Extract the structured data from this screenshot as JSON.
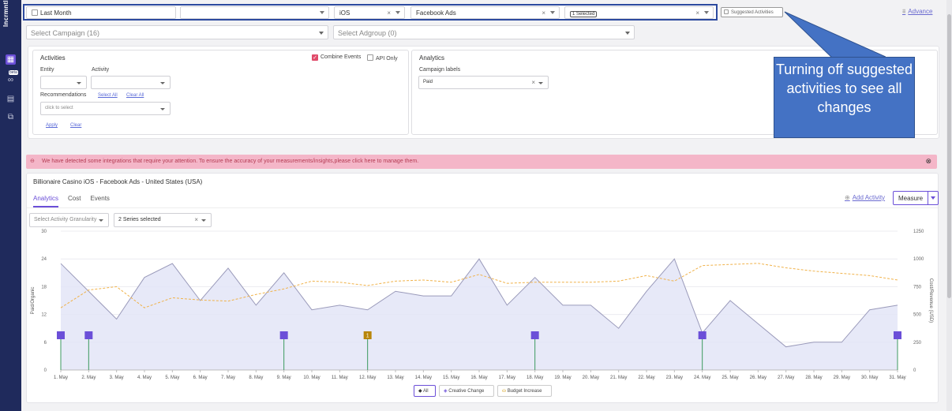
{
  "sidebar": {
    "brand": "Incrmntl",
    "beta": "beta"
  },
  "filters": {
    "date_range": "Last Month",
    "app": "",
    "platform": "iOS",
    "network": "Facebook Ads",
    "selection_count": "1 Selected",
    "suggested_activities": "Suggested Activities",
    "advance": "Advance",
    "campaign_placeholder": "Select Campaign (16)",
    "adgroup_placeholder": "Select Adgroup (0)"
  },
  "activities_panel": {
    "title": "Activities",
    "combine_events": "Combine Events",
    "api_only": "API Only",
    "entity_label": "Entity",
    "activity_label": "Activity",
    "recommendations_label": "Recommendations",
    "select_all": "Select All",
    "clear_all": "Clear All",
    "click_to_select": "click to select",
    "apply": "Apply",
    "clear": "Clear"
  },
  "analytics_panel": {
    "title": "Analytics",
    "campaign_labels": "Campaign labels",
    "campaign_label_value": "Paid"
  },
  "callout": {
    "text": "Turning off suggested activities to see all changes"
  },
  "alert": {
    "message": "We have detected some integrations that require your attention. To ensure the accuracy of your measurements/insights,please click here to manage them."
  },
  "chart_card": {
    "title": "Billionaire Casino iOS - Facebook Ads - United States (USA)",
    "tabs": [
      "Analytics",
      "Cost",
      "Events"
    ],
    "add_activity": "Add Activity",
    "measure": "Measure",
    "granularity_placeholder": "Select Activity Granularity",
    "series_selected": "2 Series selected",
    "legend": [
      "All",
      "Creative Change",
      "Budget Increase"
    ]
  },
  "colors": {
    "accent": "#6b4fd8",
    "area_line": "#9a9aba",
    "area_fill": "#e3e5f7",
    "dashed_line": "#f0b24a",
    "marker": "#6b4fd8",
    "budget_marker": "#b8860b",
    "stem": "#3c9a5f"
  },
  "chart_data": {
    "type": "area",
    "x": [
      "1. May",
      "2. May",
      "3. May",
      "4. May",
      "5. May",
      "6. May",
      "7. May",
      "8. May",
      "9. May",
      "10. May",
      "11. May",
      "12. May",
      "13. May",
      "14. May",
      "15. May",
      "16. May",
      "17. May",
      "18. May",
      "19. May",
      "20. May",
      "21. May",
      "22. May",
      "23. May",
      "24. May",
      "25. May",
      "26. May",
      "27. May",
      "28. May",
      "29. May",
      "30. May",
      "31. May"
    ],
    "y_left_ticks": [
      "0",
      "6",
      "12",
      "18",
      "24",
      "30"
    ],
    "y_right_ticks": [
      "0",
      "250",
      "500",
      "750",
      "1000",
      "1250"
    ],
    "ylabel_left": "Paid/Organic",
    "ylabel_right": "Cost/Revenue (USD)",
    "ylim_left": [
      0,
      30
    ],
    "ylim_right": [
      0,
      1250
    ],
    "series": [
      {
        "axis": "left",
        "values": [
          23,
          17,
          11,
          20,
          23,
          15,
          22,
          14,
          21,
          13,
          14,
          13,
          17,
          16,
          16,
          24,
          14,
          20,
          14,
          14,
          9,
          17,
          24,
          8,
          15,
          10,
          5,
          6,
          6,
          13,
          14
        ]
      },
      {
        "axis": "right",
        "values": [
          560,
          720,
          750,
          560,
          650,
          630,
          620,
          680,
          730,
          800,
          790,
          760,
          800,
          810,
          790,
          860,
          780,
          790,
          790,
          790,
          800,
          850,
          800,
          940,
          950,
          960,
          920,
          890,
          870,
          850,
          810
        ]
      }
    ],
    "markers": [
      {
        "x": "1. May",
        "type": "activity"
      },
      {
        "x": "2. May",
        "type": "activity"
      },
      {
        "x": "9. May",
        "type": "activity"
      },
      {
        "x": "12. May",
        "type": "budget",
        "label": "1"
      },
      {
        "x": "18. May",
        "type": "activity"
      },
      {
        "x": "24. May",
        "type": "activity"
      },
      {
        "x": "31. May",
        "type": "activity"
      }
    ]
  }
}
